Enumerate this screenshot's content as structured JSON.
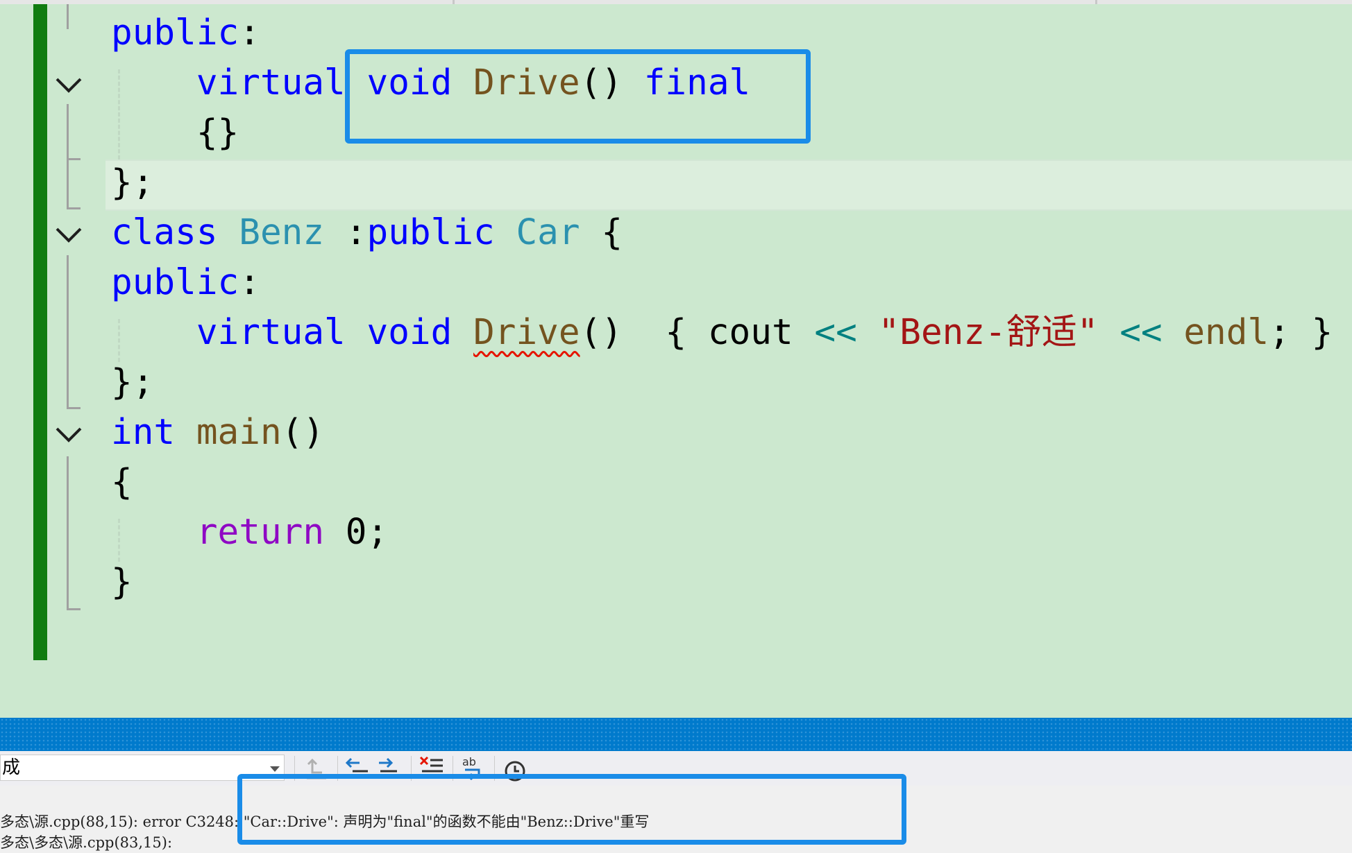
{
  "editor": {
    "lines": {
      "l1": {
        "public": "public",
        "colon": ":"
      },
      "l2": {
        "virtual": "virtual",
        "void": "void",
        "drive": "Drive",
        "parens": "()",
        "final": "final"
      },
      "l3": {
        "braces": "{}"
      },
      "l4": {
        "end": "};"
      },
      "l5": {
        "class": "class",
        "benz": "Benz",
        "colon": ":",
        "public": "public",
        "car": "Car",
        "brace": "{"
      },
      "l6": {
        "public": "public",
        "colon": ":"
      },
      "l7": {
        "virtual": "virtual",
        "void": "void",
        "drive": "Drive",
        "parens": "()",
        "open": "{",
        "cout": "cout",
        "shl1": "<<",
        "string": "\"Benz-舒适\"",
        "shl2": "<<",
        "endl": "endl",
        "semi": ";",
        "close": "}"
      },
      "l8": {
        "end": "};"
      },
      "l9": {
        "int": "int",
        "main": "main",
        "parens": "()"
      },
      "l10": {
        "brace": "{"
      },
      "l11": {
        "return": "return",
        "zero": "0",
        "semi": ";"
      },
      "l12": {
        "brace": "}"
      }
    },
    "colors": {
      "background": "#cce8cf",
      "keyword": "#0000ff",
      "type": "#2b91af",
      "function": "#74531f",
      "string": "#a31515",
      "operator": "#008080",
      "control": "#8f08c4",
      "change_bar": "#107c10",
      "highlight_box": "#1a8ce8"
    }
  },
  "output": {
    "source_selected": "成",
    "lines": [
      "多态\\源.cpp(88,15): error C3248: \"Car::Drive\": 声明为\"final\"的函数不能由\"Benz::Drive\"重写",
      "多态\\多态\\源.cpp(83,15):"
    ],
    "toolbar_icons": [
      "find-in-output-icon",
      "previous-message-icon",
      "next-message-icon",
      "clear-all-icon",
      "word-wrap-icon",
      "timestamp-icon"
    ]
  }
}
